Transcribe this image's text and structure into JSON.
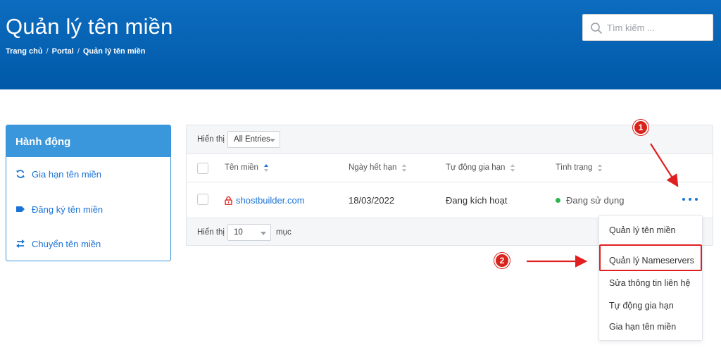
{
  "header": {
    "title": "Quản lý tên miền",
    "breadcrumb": [
      "Trang chủ",
      "Portal",
      "Quản lý tên miền"
    ],
    "search_placeholder": "Tìm kiếm ..."
  },
  "sidebar": {
    "title": "Hành động",
    "items": [
      {
        "label": "Gia hạn tên miền",
        "icon": "refresh-icon"
      },
      {
        "label": "Đăng ký tên miền",
        "icon": "tag-icon"
      },
      {
        "label": "Chuyển tên miền",
        "icon": "transfer-icon"
      }
    ]
  },
  "table": {
    "show_label": "Hiển thị",
    "entries_value": "All Entries",
    "columns": [
      "Tên miền",
      "Ngày hết hạn",
      "Tự động gia hạn",
      "Tình trạng"
    ],
    "rows": [
      {
        "domain": "shostbuilder.com",
        "expiry": "18/03/2022",
        "auto_renew": "Đang kích hoạt",
        "status": "Đang sử dụng"
      }
    ],
    "footer_show_label": "Hiển thị",
    "page_size": "10",
    "page_size_suffix": "mục"
  },
  "dropdown_menu": {
    "items": [
      "Quản lý tên miền",
      "Quản lý Nameservers",
      "Sửa thông tin liên hệ",
      "Tự động gia hạn",
      "Gia hạn tên miền"
    ]
  },
  "annotations": {
    "badge_1": "1",
    "badge_2": "2"
  },
  "colors": {
    "header_blue": "#0064b4",
    "link_blue": "#1a73d6",
    "sidebar_head": "#3a97dc",
    "status_green": "#2bb54b",
    "annotation_red": "#d8241c"
  }
}
